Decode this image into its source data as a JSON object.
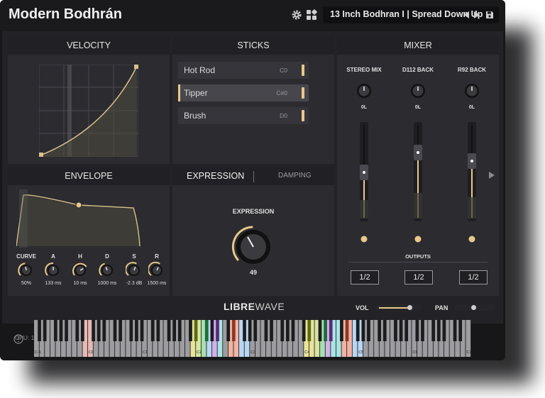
{
  "header": {
    "title": "Modern Bodhrán",
    "preset": "13 Inch Bodhran I | Spread Down Up",
    "icons": [
      "gear-icon",
      "grid-icon",
      "prev-arrow-icon",
      "next-arrow-icon",
      "save-icon"
    ]
  },
  "velocity": {
    "title": "VELOCITY"
  },
  "sticks": {
    "title": "STICKS",
    "items": [
      {
        "label": "Hot Rod",
        "note": "C0"
      },
      {
        "label": "Tipper",
        "note": "C#0"
      },
      {
        "label": "Brush",
        "note": "D0"
      }
    ],
    "selected_index": 1
  },
  "mixer": {
    "title": "MIXER",
    "channels": [
      {
        "name": "STEREO MIX",
        "pan": "0L",
        "output": "1/2"
      },
      {
        "name": "D112 BACK",
        "pan": "0L",
        "output": "1/2"
      },
      {
        "name": "R92 BACK",
        "pan": "0L",
        "output": "1/2"
      }
    ],
    "outputs_label": "OUTPUTS"
  },
  "envelope": {
    "title": "ENVELOPE",
    "knobs": [
      {
        "label": "CURVE",
        "value": "50%"
      },
      {
        "label": "A",
        "value": "133 ms"
      },
      {
        "label": "H",
        "value": "10 ms"
      },
      {
        "label": "D",
        "value": "1000 ms"
      },
      {
        "label": "S",
        "value": "-2.3 dB"
      },
      {
        "label": "R",
        "value": "1500 ms"
      }
    ]
  },
  "expression": {
    "tabs": [
      "EXPRESSION",
      "DAMPING"
    ],
    "label": "EXPRESSION",
    "value": "49"
  },
  "footer": {
    "status": "CPU: 1.2% | RAM: 33.5MB | Voices: 36",
    "logo_bold": "LIBRE",
    "logo_light": "WAVE",
    "vol_label": "VOL",
    "pan_label": "PAN"
  },
  "keyboard": {
    "octave_labels": [
      "C-1",
      "C0",
      "C1",
      "C2",
      "C3",
      "C4",
      "C5",
      "C6",
      "C7"
    ]
  },
  "colors": {
    "accent": "#e8c98a",
    "bg": "#17171a",
    "panel": "#2b2b30"
  }
}
